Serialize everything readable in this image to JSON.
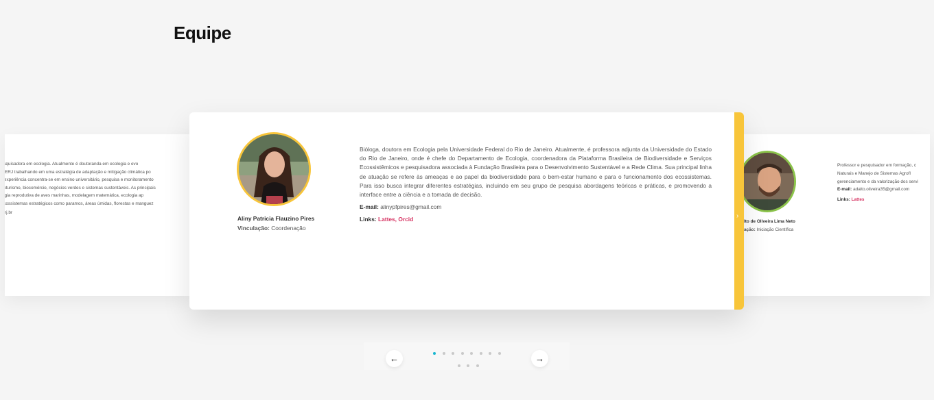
{
  "section": {
    "title": "Equipe"
  },
  "left_card": {
    "lines": [
      "ia – pesquisadora em ecologia. Atualmente é doutoranda em ecologia e evo",
      "eiro - UERJ trabalhando em uma estratégia de adaptação e mitigação climática po",
      "s. Sua experiência concentra-se em ensino universitário, pesquisa e monitoramento",
      "nto, ecoturismo, biocomércio, negócios verdes e sistemas sustentáveis. As principais",
      "o ecologia reprodutiva de aves marinhas, modelagem matemática, ecologia ap",
      "s em ecossistemas estratégicos como paramos, áreas úmidas, florestas e manguez"
    ],
    "email_tail": "rj.br"
  },
  "main_card": {
    "name": "Aliny Patricia Flauzino Pires",
    "vinculacao_label": "Vinculação:",
    "vinculacao_value": "Coordenação",
    "bio": "Bióloga, doutora em Ecologia pela Universidade Federal do Rio de Janeiro. Atualmente, é professora adjunta da Universidade do Estado do Rio de Janeiro, onde é chefe do Departamento de Ecologia, coordenadora da Plataforma Brasileira de Biodiversidade e Serviços Ecossistêmicos e pesquisadora associada à Fundação Brasileira para o Desenvolvimento Sustentável e a Rede Clima. Sua principal linha de atuação se refere às ameaças e ao papel da biodiversidade para o bem-estar humano e para o funcionamento dos ecossistemas. Para isso busca integrar diferentes estratégias, incluindo em seu grupo de pesquisa abordagens teóricas e práticas, e promovendo a interface entre a ciência e a tomada de decisão.",
    "email_label": "E-mail:",
    "email_value": "alinypfpires@gmail.com",
    "links_label": "Links:",
    "link_lattes": "Lattes",
    "link_sep": ", ",
    "link_orcid": "Orcid",
    "accent_color": "#f8c53a"
  },
  "right_card": {
    "name": "lto de Oliveira Lima Neto",
    "vinculacao_label": "ação:",
    "vinculacao_value": "Iniciação Científica",
    "bio_lines": [
      "Professor e pesquisador em formação, c",
      "Naturais e Manejo de Sistemas Agrofl",
      "gerenciamento e da valorização dos servi"
    ],
    "email_label": "E-mail:",
    "email_value": "adalto.oliveira35@gmail.com",
    "links_label": "Links:",
    "link_lattes": "Lattes",
    "accent_color": "#8bc34a"
  },
  "navigation": {
    "prev_icon": "←",
    "next_icon": "→",
    "total_dots": 11,
    "active_index": 0,
    "dot_active_color": "#17b6cf"
  }
}
